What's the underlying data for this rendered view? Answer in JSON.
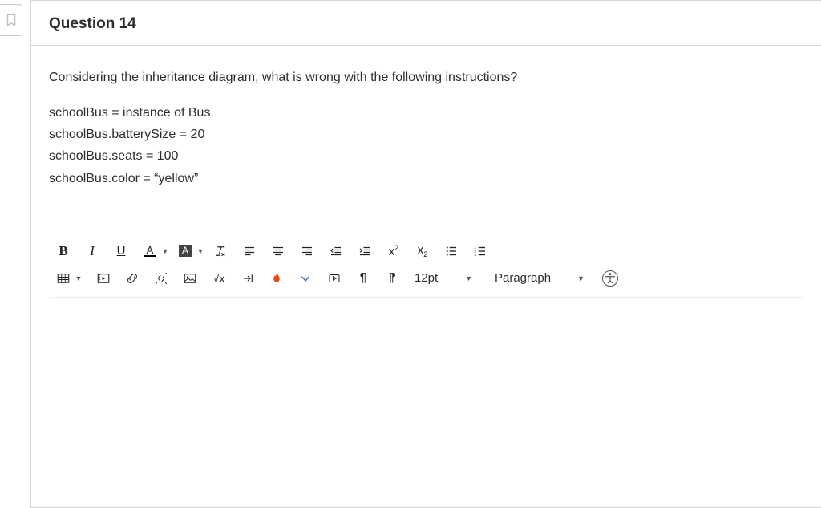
{
  "header": {
    "title": "Question 14"
  },
  "question": {
    "prompt": "Considering the inheritance diagram, what is wrong with the following instructions?",
    "code": [
      "schoolBus = instance of Bus",
      "schoolBus.batterySize = 20",
      "schoolBus.seats = 100",
      "schoolBus.color = “yellow”"
    ]
  },
  "toolbar": {
    "bold": "B",
    "italic": "I",
    "underline": "U",
    "textcolor": "A",
    "highlight": "A",
    "fontsize": "12pt",
    "block": "Paragraph"
  }
}
